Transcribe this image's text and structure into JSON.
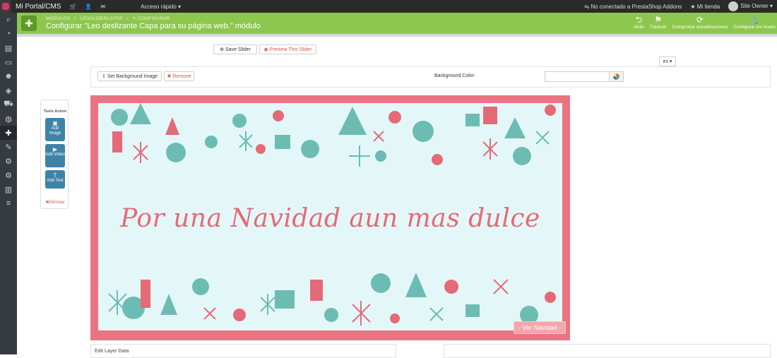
{
  "topbar": {
    "brand": "Mi Portal/CMS",
    "quick_access": "Acceso rápido ▾",
    "addons_status": "No conectado a PrestaShop Addons",
    "my_store": "Mi tienda",
    "user": "Site Owner ▾",
    "icons": [
      "cart-icon",
      "user-icon",
      "mail-icon"
    ]
  },
  "header": {
    "breadcrumb": [
      "MÓDULOS",
      "/",
      "LEOSLIDERLAYER",
      "/",
      "✎ CONFIGURAR"
    ],
    "title": "Configurar \"Leo deslizante Capa para su página web.\" módulo",
    "toolbar": [
      {
        "icon": "back-icon",
        "glyph": "⮌",
        "label": "Atrás"
      },
      {
        "icon": "flag-icon",
        "glyph": "⚑",
        "label": "Traducir"
      },
      {
        "icon": "refresh-icon",
        "glyph": "⟳",
        "label": "Comprobar actualizaciones"
      },
      {
        "icon": "anchor-icon",
        "glyph": "⚓",
        "label": "Configurar los hooks"
      }
    ]
  },
  "actions": {
    "save_slider": "Save Slider",
    "preview_slider": "Preview This Slider",
    "language": "es ▾"
  },
  "background": {
    "set_image": "Set Background Image",
    "remove": "Remove",
    "color_label": "Background Color:",
    "color_value": ""
  },
  "tools": {
    "title": "Tools Action",
    "add_image": "Add Image",
    "add_video": "Add Video",
    "add_text": "Add Text",
    "delete": "Eliminar"
  },
  "slide": {
    "headline": "Por una Navidad aun mas dulce",
    "button": "- Ver Navidad -",
    "frame_color": "#ea7481",
    "background_color": "#e4f7f8"
  },
  "bottom": {
    "left_label": "Edit Layer Data"
  },
  "colors": {
    "header": "#8ec74e",
    "topbar": "#2a2a2a",
    "accent_blue": "#3e83a6",
    "danger": "#d9534f"
  }
}
